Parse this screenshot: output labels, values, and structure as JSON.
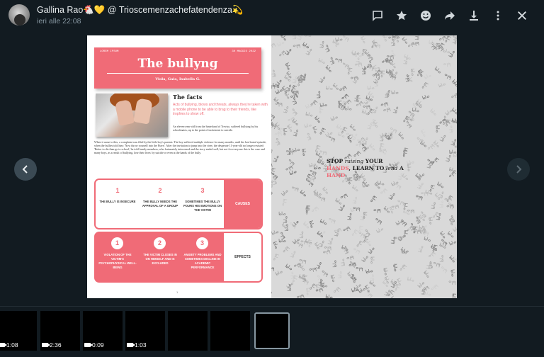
{
  "header": {
    "sender": "Gallina Rao🐔💛 @ Trioscemenzachefatendenza💫",
    "timestamp": "ieri alle 22:08",
    "actions": [
      "reply-icon",
      "star-icon",
      "emoji-icon",
      "forward-icon",
      "download-icon",
      "more-icon",
      "close-icon"
    ]
  },
  "document": {
    "header_left": "LOREM IPSUM",
    "header_right": "30 MAGGIO 2022",
    "title": "The bullyng",
    "authors": "Viola, Gaia, Isabella G.",
    "facts_title": "The facts",
    "facts_lead": "Acts of bullying, blows and threats, always they're taken with a mobile phone to be able to brag to their friends, like trophies to show off.",
    "facts_body_1": "An eleven-year-old from the hinterland of Treviso, suffered bullying by his schoolmates, up to the point of incitement to suicide.",
    "facts_body_2": "When it came to this, a complaint was filed by the little boy's parents. The boy suffered multiple violence for many months, until the last brutal episode, when the bullies told him: 'Now throw yourself into the Piave'. After the invitation to jump into the river, the desperate 11-year-old no longer resisted: 'Better to die than go to school,' he told family members, who fortunately intervened and the story ended well, but not for everyone this is the case and many boys, as a result of bullying, lose their lives: by suicide or even at the hands of the bully.",
    "causes_label": "CAUSES",
    "causes": [
      {
        "num": "1",
        "text": "THE BULLY IS INSECURE"
      },
      {
        "num": "2",
        "text": "THE BULLY NEEDS THE APPROVAL OF A GROUP"
      },
      {
        "num": "3",
        "text": "SOMETIMES THE BULLY POURS HIS EMOTIONS ON THE VICTIM"
      }
    ],
    "effects_label": "EFFECTS",
    "effects": [
      {
        "num": "1",
        "text": "VIOLATION OF THE VICTIM'S PSYCHOPHYSICAL WELL-BEING"
      },
      {
        "num": "2",
        "text": "THE VICTIM CLOSES IN ON HIMSELF AND IS EXCLUDED"
      },
      {
        "num": "3",
        "text": "ANXIETY PROBLEMS AND SOMETIMES DECLINE IN ACADEMIC PERFORMANCE"
      }
    ],
    "page_number": "1",
    "quote": {
      "part1": "STOP ",
      "part2": "raising",
      "part3": " YOUR ",
      "part4": "HANDS",
      "part5": ", LEARN TO ",
      "part6": "lend",
      "part7": " A ",
      "part8": "HAND"
    }
  },
  "thumbnails": [
    {
      "duration": "1:08"
    },
    {
      "duration": "2:36"
    },
    {
      "duration": "0:09"
    },
    {
      "duration": "1:03"
    },
    {
      "duration": ""
    },
    {
      "duration": ""
    }
  ],
  "colors": {
    "accent": "#f06b77",
    "background": "#121b21"
  }
}
